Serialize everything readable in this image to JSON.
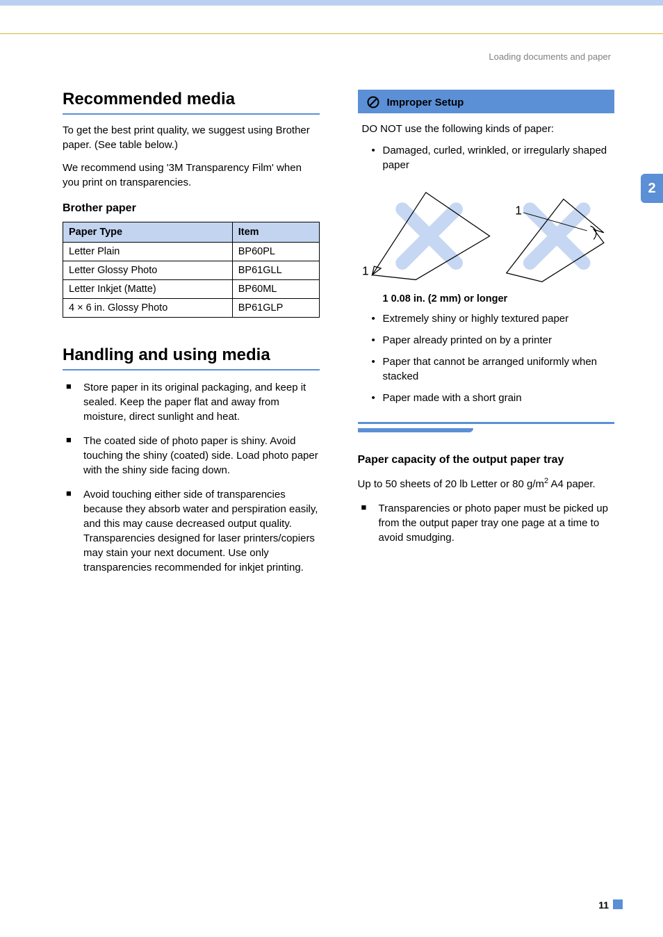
{
  "header": {
    "section": "Loading documents and paper"
  },
  "sideTab": "2",
  "pageNumber": "11",
  "left": {
    "h1a": "Recommended media",
    "p1": "To get the best print quality, we suggest using Brother paper. (See table below.)",
    "p2": "We recommend using '3M Transparency Film' when you print on transparencies.",
    "h3a": "Brother paper",
    "table": {
      "headers": [
        "Paper Type",
        "Item"
      ],
      "rows": [
        [
          "Letter Plain",
          "BP60PL"
        ],
        [
          "Letter Glossy Photo",
          "BP61GLL"
        ],
        [
          "Letter Inkjet (Matte)",
          "BP60ML"
        ],
        [
          "4 × 6 in. Glossy Photo",
          "BP61GLP"
        ]
      ]
    },
    "h1b": "Handling and using media",
    "bullets": [
      "Store paper in its original packaging, and keep it sealed. Keep the paper flat and away from moisture, direct sunlight and heat.",
      "The coated side of photo paper is shiny. Avoid touching the shiny (coated) side. Load photo paper with the shiny side facing down.",
      "Avoid touching either side of transparencies because they absorb water and perspiration easily, and this may cause decreased output quality. Transparencies designed for laser printers/copiers may stain your next document. Use only transparencies recommended for inkjet printing."
    ]
  },
  "right": {
    "improperTitle": "Improper Setup",
    "donot": "DO NOT use the following kinds of paper:",
    "firstBullet": "Damaged, curled, wrinkled, or irregularly shaped paper",
    "diagramLabelLeft": "1",
    "diagramLabelRight": "1",
    "caption": "1    0.08 in. (2 mm) or longer",
    "otherBullets": [
      "Extremely shiny or highly textured paper",
      "Paper already printed on by a printer",
      "Paper that cannot be arranged uniformly when stacked",
      "Paper made with a short grain"
    ],
    "capacityTitle": "Paper capacity of the output paper tray",
    "capacityText1": "Up to 50 sheets of 20 lb Letter or 80 g/m",
    "capacityText2": " A4 paper.",
    "capacityBullet": "Transparencies or photo paper must be picked up from the output paper tray one page at a time to avoid smudging."
  }
}
